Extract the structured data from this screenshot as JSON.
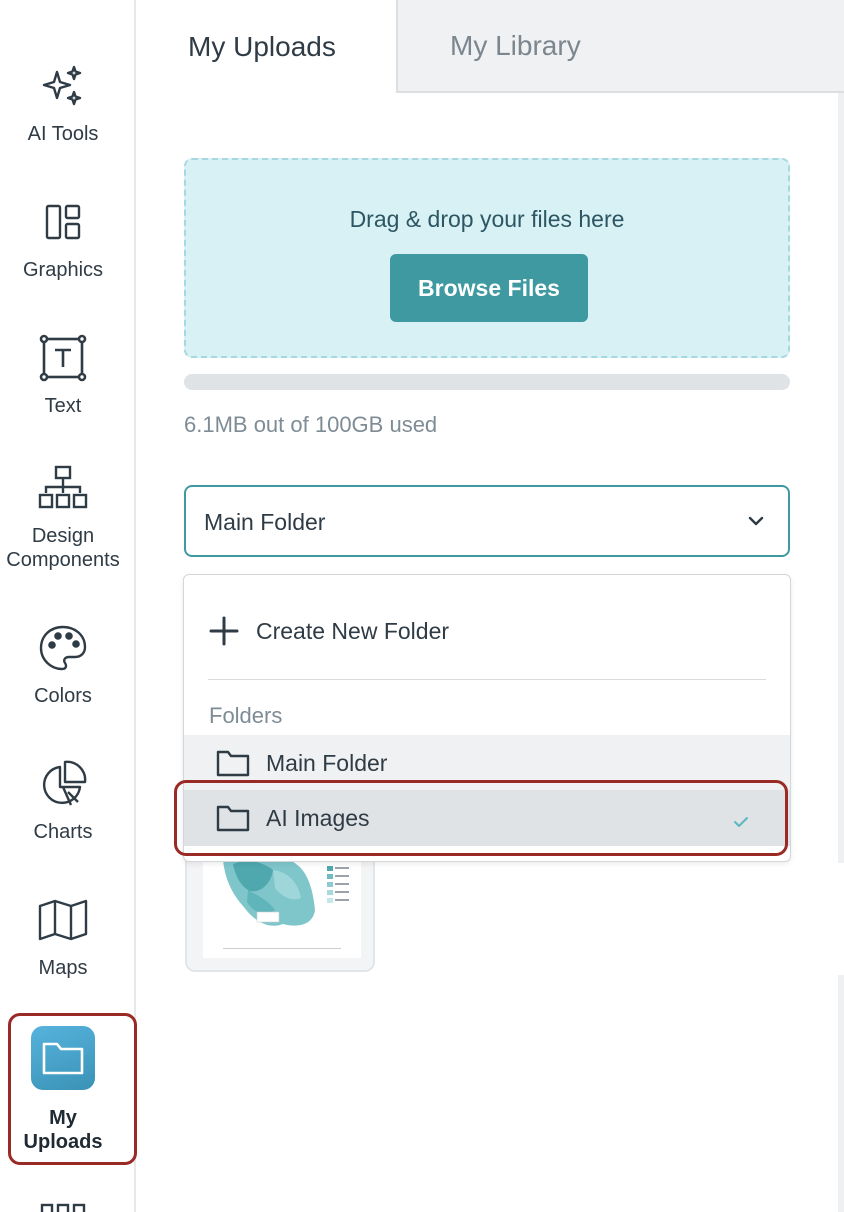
{
  "sidebar": {
    "items": [
      {
        "label": "AI Tools",
        "icon": "sparkles-icon"
      },
      {
        "label": "Graphics",
        "icon": "layout-icon"
      },
      {
        "label": "Text",
        "icon": "text-icon"
      },
      {
        "label": "Design Components",
        "icon": "hierarchy-icon"
      },
      {
        "label": "Colors",
        "icon": "palette-icon"
      },
      {
        "label": "Charts",
        "icon": "pie-chart-icon"
      },
      {
        "label": "Maps",
        "icon": "map-icon"
      },
      {
        "label": "My Uploads",
        "icon": "folder-icon",
        "active": true
      }
    ]
  },
  "tabs": {
    "uploads": "My Uploads",
    "library": "My Library"
  },
  "upload": {
    "drop_text": "Drag & drop your files here",
    "browse_label": "Browse Files",
    "storage_text": "6.1MB out of 100GB used",
    "storage_fraction": 6.1e-05
  },
  "folder_select": {
    "value": "Main Folder"
  },
  "menu": {
    "create_label": "Create New Folder",
    "folders_heading": "Folders",
    "folders": [
      {
        "label": "Main Folder"
      },
      {
        "label": "AI Images",
        "selected": true
      }
    ]
  },
  "colors": {
    "accent": "#3e9aa0",
    "dropzone_bg": "#d8f1f5",
    "highlight": "#9a2a26"
  }
}
